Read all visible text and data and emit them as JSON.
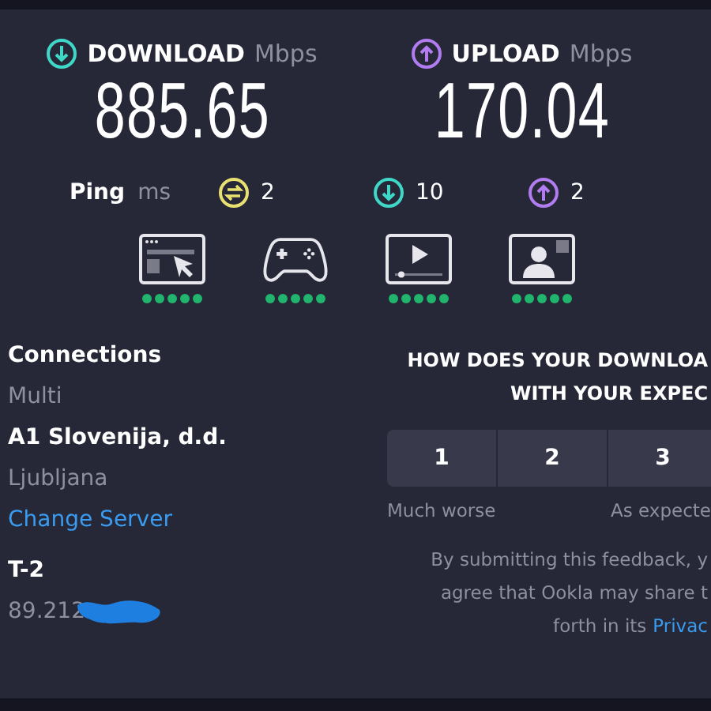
{
  "results": [
    {
      "kind": "download",
      "label": "DOWNLOAD",
      "unit": "Mbps",
      "value": "885.65"
    },
    {
      "kind": "upload",
      "label": "UPLOAD",
      "unit": "Mbps",
      "value": "170.04"
    }
  ],
  "ping": {
    "label": "Ping",
    "unit": "ms",
    "readings": [
      {
        "kind": "idle",
        "value": "2"
      },
      {
        "kind": "download",
        "value": "10"
      },
      {
        "kind": "upload",
        "value": "2"
      }
    ]
  },
  "ratings": [
    {
      "kind": "browsing",
      "stars": 5
    },
    {
      "kind": "gaming",
      "stars": 5
    },
    {
      "kind": "streaming",
      "stars": 5
    },
    {
      "kind": "video_call",
      "stars": 5
    }
  ],
  "connection": {
    "heading": "Connections",
    "mode": "Multi",
    "server_name": "A1 Slovenija, d.d.",
    "server_city": "Ljubljana",
    "change_link": "Change Server",
    "provider": "T-2",
    "ip": "89.212"
  },
  "feedback": {
    "question_lines": [
      "HOW DOES YOUR DOWNLOA",
      "WITH YOUR EXPEC"
    ],
    "options": [
      "1",
      "2",
      "3"
    ],
    "low_label": "Much worse",
    "mid_label": "As expecte",
    "notice_lines": [
      "By submitting this feedback, y",
      "agree that Ookla may share t",
      "forth in its"
    ],
    "notice_link": "Privac"
  }
}
